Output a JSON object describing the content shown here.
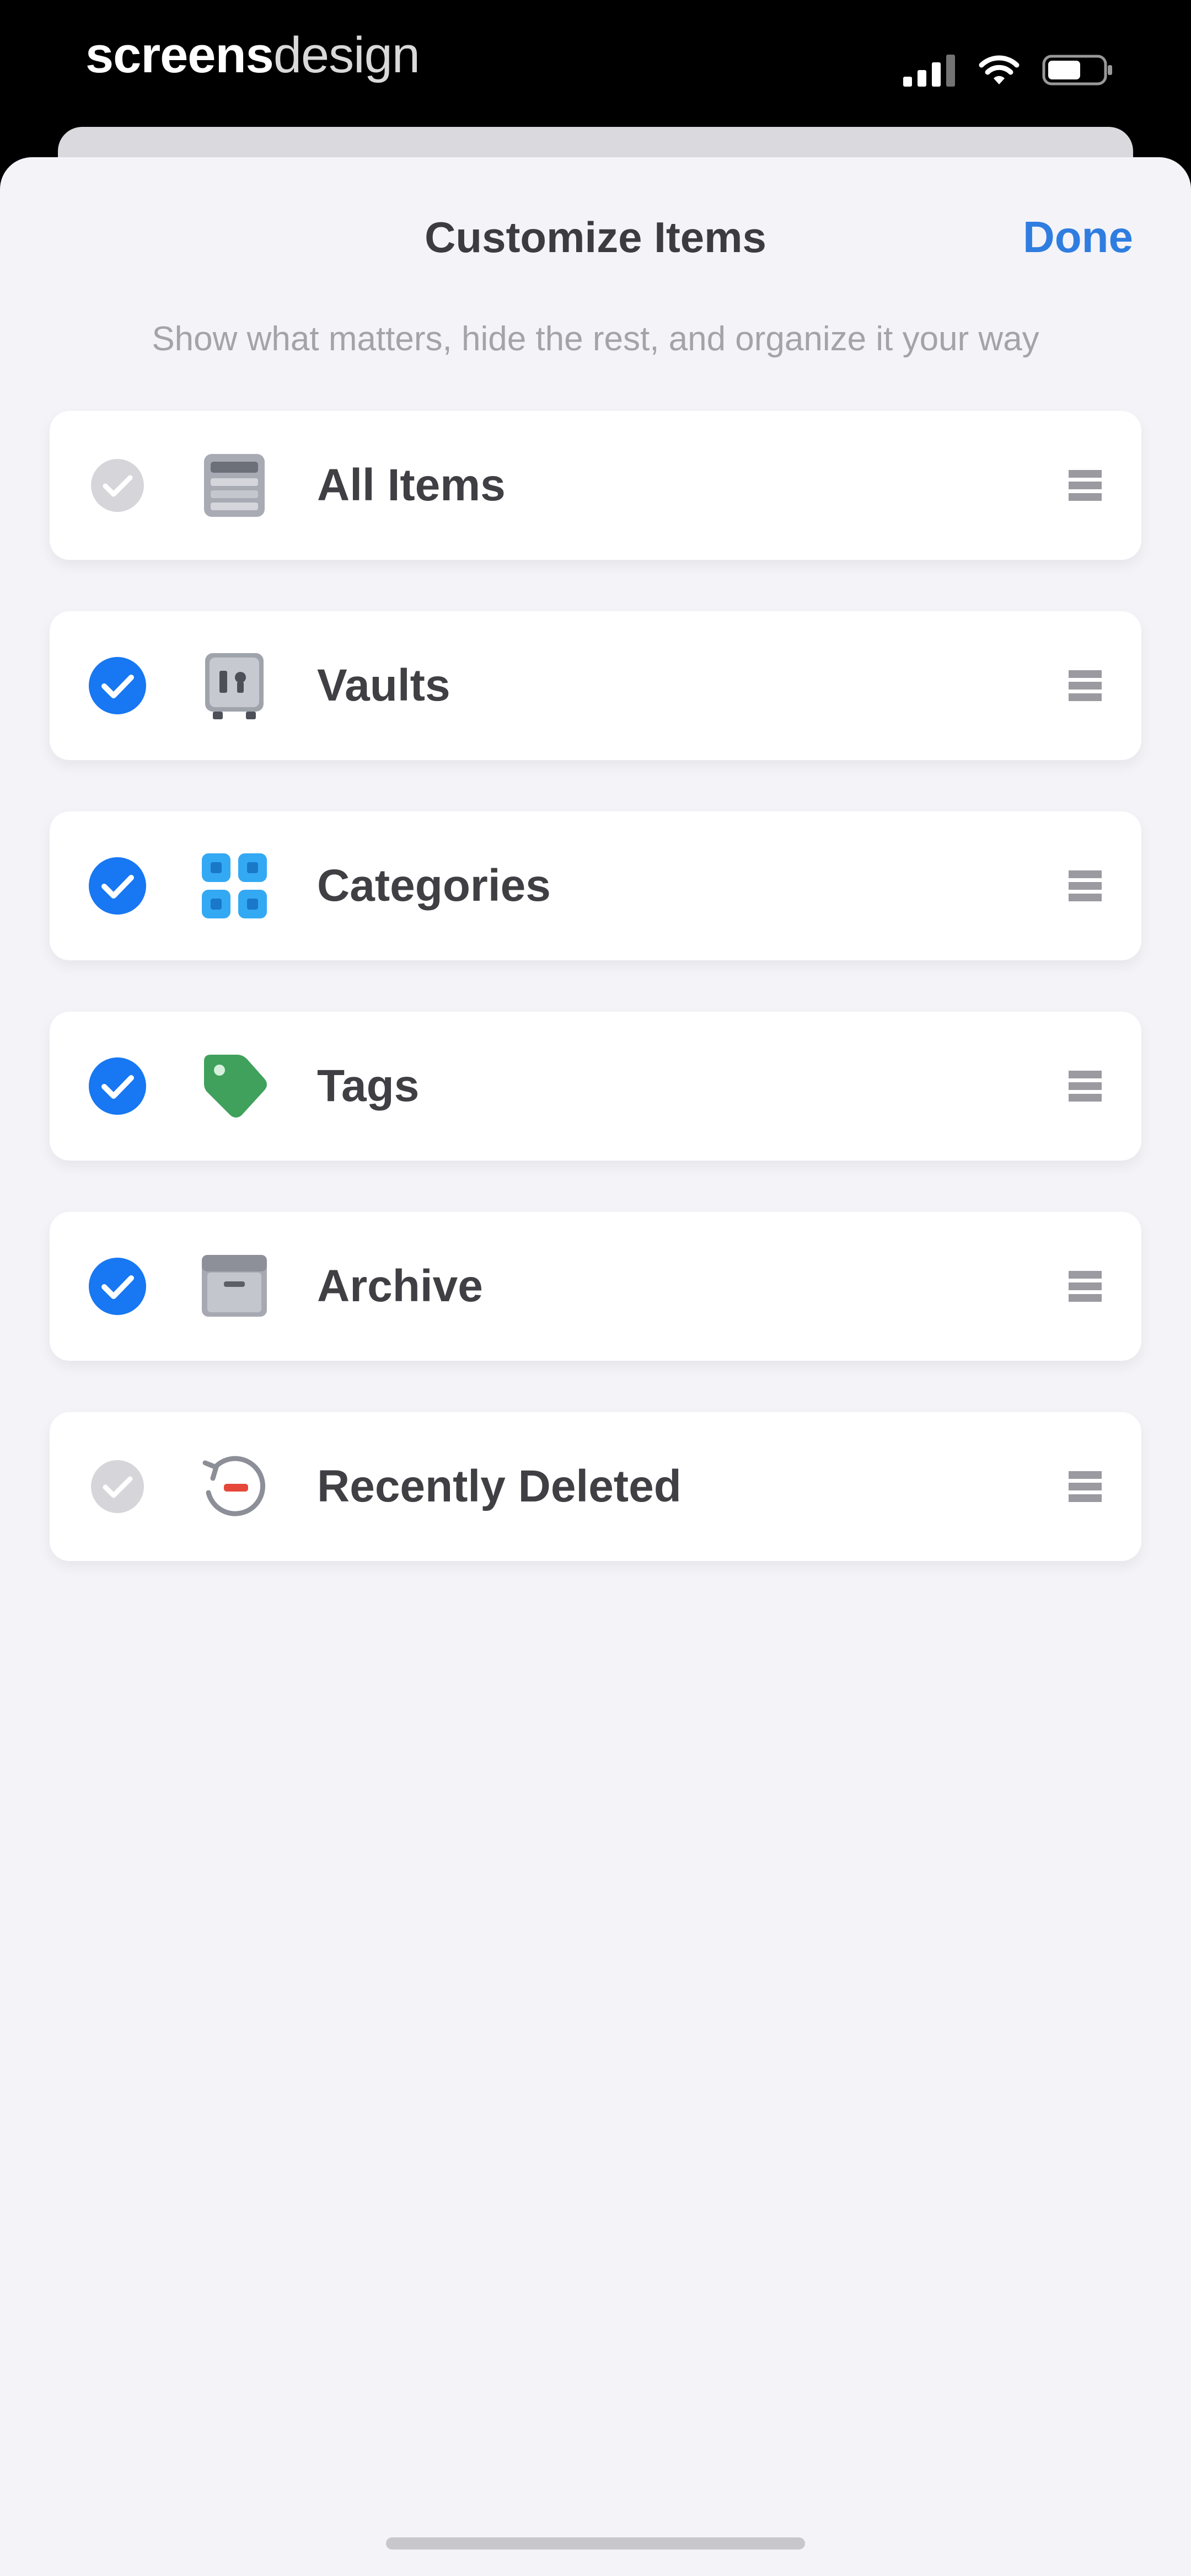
{
  "status_bar": {
    "brand_bold": "screens",
    "brand_light": "design",
    "icons": [
      "cellular-signal-icon",
      "wifi-icon",
      "battery-icon"
    ]
  },
  "sheet": {
    "title": "Customize Items",
    "done_label": "Done",
    "subtitle": "Show what matters, hide the rest, and organize it your way"
  },
  "items": [
    {
      "label": "All Items",
      "checked": false,
      "icon": "all-items-icon"
    },
    {
      "label": "Vaults",
      "checked": true,
      "icon": "vault-icon"
    },
    {
      "label": "Categories",
      "checked": true,
      "icon": "categories-grid-icon"
    },
    {
      "label": "Tags",
      "checked": true,
      "icon": "tag-icon"
    },
    {
      "label": "Archive",
      "checked": true,
      "icon": "archive-box-icon"
    },
    {
      "label": "Recently Deleted",
      "checked": false,
      "icon": "recently-deleted-icon"
    }
  ],
  "colors": {
    "accent": "#1877F2",
    "done": "#2F7DE0",
    "unchecked": "#D2D2D6",
    "tag_green": "#3FA15B",
    "category_blue": "#33A9F4",
    "deleted_red": "#E5483A"
  }
}
